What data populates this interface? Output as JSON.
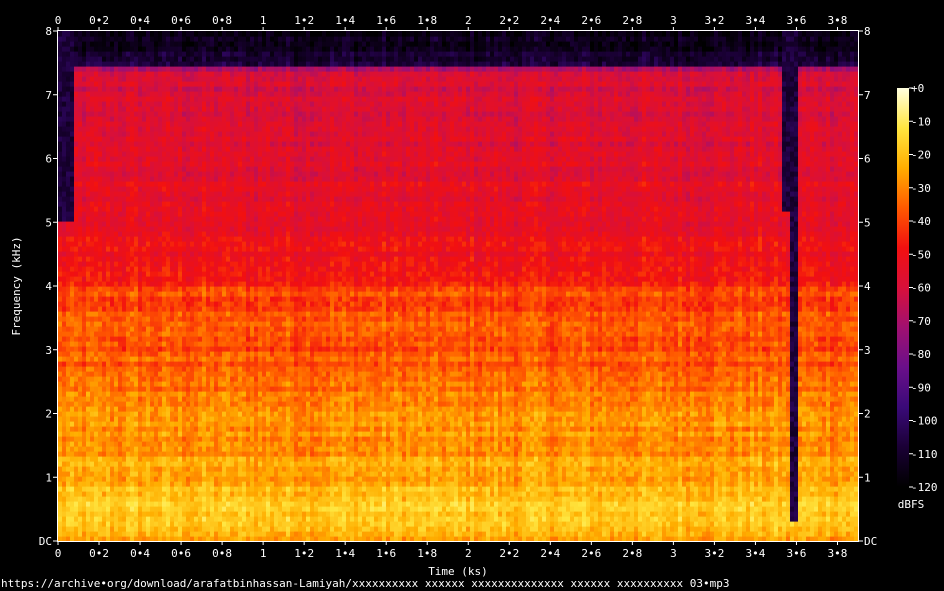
{
  "chart_data": {
    "type": "heatmap",
    "title": "",
    "xlabel": "Time (ks)",
    "ylabel": "Frequency (kHz)",
    "xlim": [
      0,
      3.9
    ],
    "ylim": [
      0,
      8
    ],
    "x_ticks": [
      0,
      0.2,
      0.4,
      0.6,
      0.8,
      1,
      1.2,
      1.4,
      1.6,
      1.8,
      2,
      2.2,
      2.4,
      2.6,
      2.8,
      3,
      3.2,
      3.4,
      3.6,
      3.8
    ],
    "x_tick_labels": [
      "0",
      "0•2",
      "0•4",
      "0•6",
      "0•8",
      "1",
      "1•2",
      "1•4",
      "1•6",
      "1•8",
      "2",
      "2•2",
      "2•4",
      "2•6",
      "2•8",
      "3",
      "3•2",
      "3•4",
      "3•6",
      "3•8"
    ],
    "y_ticks": [
      0,
      1,
      2,
      3,
      4,
      5,
      6,
      7,
      8
    ],
    "y_tick_labels": [
      "DC",
      "1",
      "2",
      "3",
      "4",
      "5",
      "6",
      "7",
      "8"
    ],
    "colorbar": {
      "label": "dBFS",
      "range": [
        -120,
        0
      ],
      "ticks": [
        0,
        -10,
        -20,
        -30,
        -40,
        -50,
        -60,
        -70,
        -80,
        -90,
        -100,
        -110,
        -120
      ],
      "tick_labels": [
        "+0",
        "-10",
        "-20",
        "-30",
        "-40",
        "-50",
        "-60",
        "-70",
        "-80",
        "-90",
        "-100",
        "-110",
        "-120"
      ]
    },
    "colormap": [
      "#000000",
      "#1a0035",
      "#3a0a78",
      "#6a0f8a",
      "#a01070",
      "#d8103a",
      "#f21010",
      "#ff5a00",
      "#ffae00",
      "#ffe640",
      "#ffffe0"
    ],
    "spectrum_profile": {
      "frequency_khz": [
        0,
        0.1,
        0.3,
        0.6,
        1,
        1.5,
        2,
        2.5,
        3,
        3.5,
        3.9,
        4.2,
        5,
        6,
        7,
        7.4,
        7.5,
        8
      ],
      "level_dbfs": [
        -30,
        -22,
        -18,
        -20,
        -24,
        -28,
        -30,
        -34,
        -38,
        -38,
        -40,
        -50,
        -52,
        -56,
        -58,
        -62,
        -110,
        -118
      ]
    },
    "dropouts": [
      {
        "start_ks": 0.0,
        "end_ks": 0.06,
        "above_khz": 5.0
      },
      {
        "start_ks": 3.52,
        "end_ks": 3.56,
        "above_khz": 5.1
      },
      {
        "start_ks": 3.56,
        "end_ks": 3.59,
        "above_khz": 0.3
      }
    ]
  },
  "footer": {
    "source_url": "https://archive•org/download/arafatbinhassan-Lamiyah/xxxxxxxxxx xxxxxx xxxxxxxxxxxxxx xxxxxx xxxxxxxxxx 03•mp3"
  }
}
